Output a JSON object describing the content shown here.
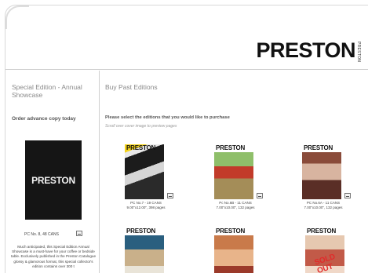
{
  "brand": {
    "logo": "PRESTON",
    "logo_sub": "PRESTON"
  },
  "sidebar": {
    "title": "Special Edition - Annual Showcase",
    "order_link": "Order advance copy today",
    "cover_logo": "PRESTON",
    "caption": "PC No. 8, 48 CANS",
    "description": "Much anticipated, this Special Edition Annual Showcase is a must-have for your coffee or bedside table. Exclusively published in the Preston Catalogue glossy & glamorous format, this special collector's edition contains over 300 t"
  },
  "main": {
    "title": "Buy Past Editions",
    "instructions": "Please select the editions that you would like to purchase",
    "hint": "Scroll over cover image to preview pages",
    "items": [
      {
        "logo": "PRESTON",
        "caption1": "PC No.7 - 19 CANS",
        "caption2": "9.00\"x12.00\", 398 pages"
      },
      {
        "logo": "PRESTON",
        "caption1": "Pc No.6B - 11 CANS",
        "caption2": "7.00\"x10.00\", 132 pages"
      },
      {
        "logo": "PRESTON",
        "caption1": "PC No.6A - 11 CANS",
        "caption2": "7.00\"x10.00\", 132 pages"
      },
      {
        "logo": "PRESTON"
      },
      {
        "logo": "PRESTON"
      },
      {
        "logo": "PRESTON",
        "badge": "SOLD OUT"
      }
    ]
  }
}
